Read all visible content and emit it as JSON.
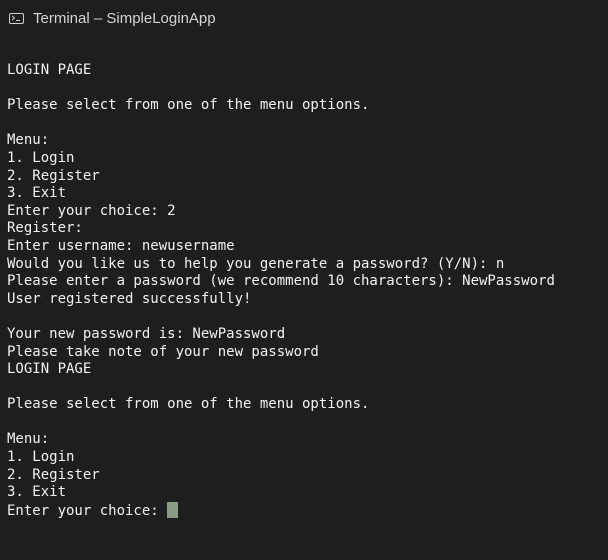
{
  "window": {
    "title": "Terminal – SimpleLoginApp",
    "icon": "terminal-icon"
  },
  "colors": {
    "background": "#1e1e1e",
    "text": "#f2f2f2",
    "title_text": "#d4d4d4",
    "cursor": "#8a9a86"
  },
  "terminal": {
    "lines": [
      "LOGIN PAGE",
      "",
      "Please select from one of the menu options.",
      "",
      "Menu:",
      "1. Login",
      "2. Register",
      "3. Exit",
      "Enter your choice: 2",
      "Register:",
      "Enter username: newusername",
      "Would you like us to help you generate a password? (Y/N): n",
      "Please enter a password (we recommend 10 characters): NewPassword",
      "User registered successfully!",
      "",
      "Your new password is: NewPassword",
      "Please take note of your new password",
      "LOGIN PAGE",
      "",
      "Please select from one of the menu options.",
      "",
      "Menu:",
      "1. Login",
      "2. Register",
      "3. Exit"
    ],
    "prompt": "Enter your choice: "
  }
}
